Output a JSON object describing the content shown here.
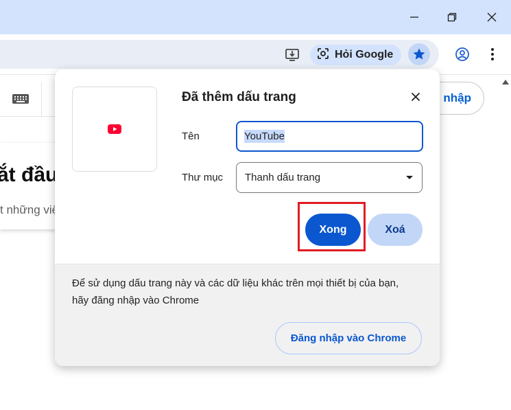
{
  "titlebar": {
    "minimize_icon": "minimize-icon",
    "restore_icon": "restore-icon",
    "close_icon": "close-icon"
  },
  "toolbar": {
    "install_icon": "install-app-icon",
    "hoi_google_label": "Hỏi Google",
    "lens_icon": "lens-icon",
    "star_icon": "star-icon",
    "profile_icon": "profile-icon",
    "menu_icon": "more-menu-icon"
  },
  "page": {
    "heading": "ắt đầu",
    "subtext": "t những việ",
    "signin_label": "g nhập",
    "keyboard_icon": "keyboard-icon"
  },
  "bubble": {
    "title": "Đã thêm dấu trang",
    "name_label": "Tên",
    "name_value": "YouTube",
    "folder_label": "Thư mục",
    "folder_value": "Thanh dấu trang",
    "done_label": "Xong",
    "remove_label": "Xoá",
    "footer_text": "Để sử dụng dấu trang này và các dữ liệu khác trên mọi thiết bị của bạn, hãy đăng nhập vào Chrome",
    "signin_button": "Đăng nhập vào Chrome",
    "favicon": "youtube-icon"
  },
  "colors": {
    "accent": "#0b57d0",
    "tonal": "#c2d6f7",
    "titlebar": "#d3e3fd",
    "highlight": "#e01b24",
    "youtube_red": "#ff0033"
  }
}
